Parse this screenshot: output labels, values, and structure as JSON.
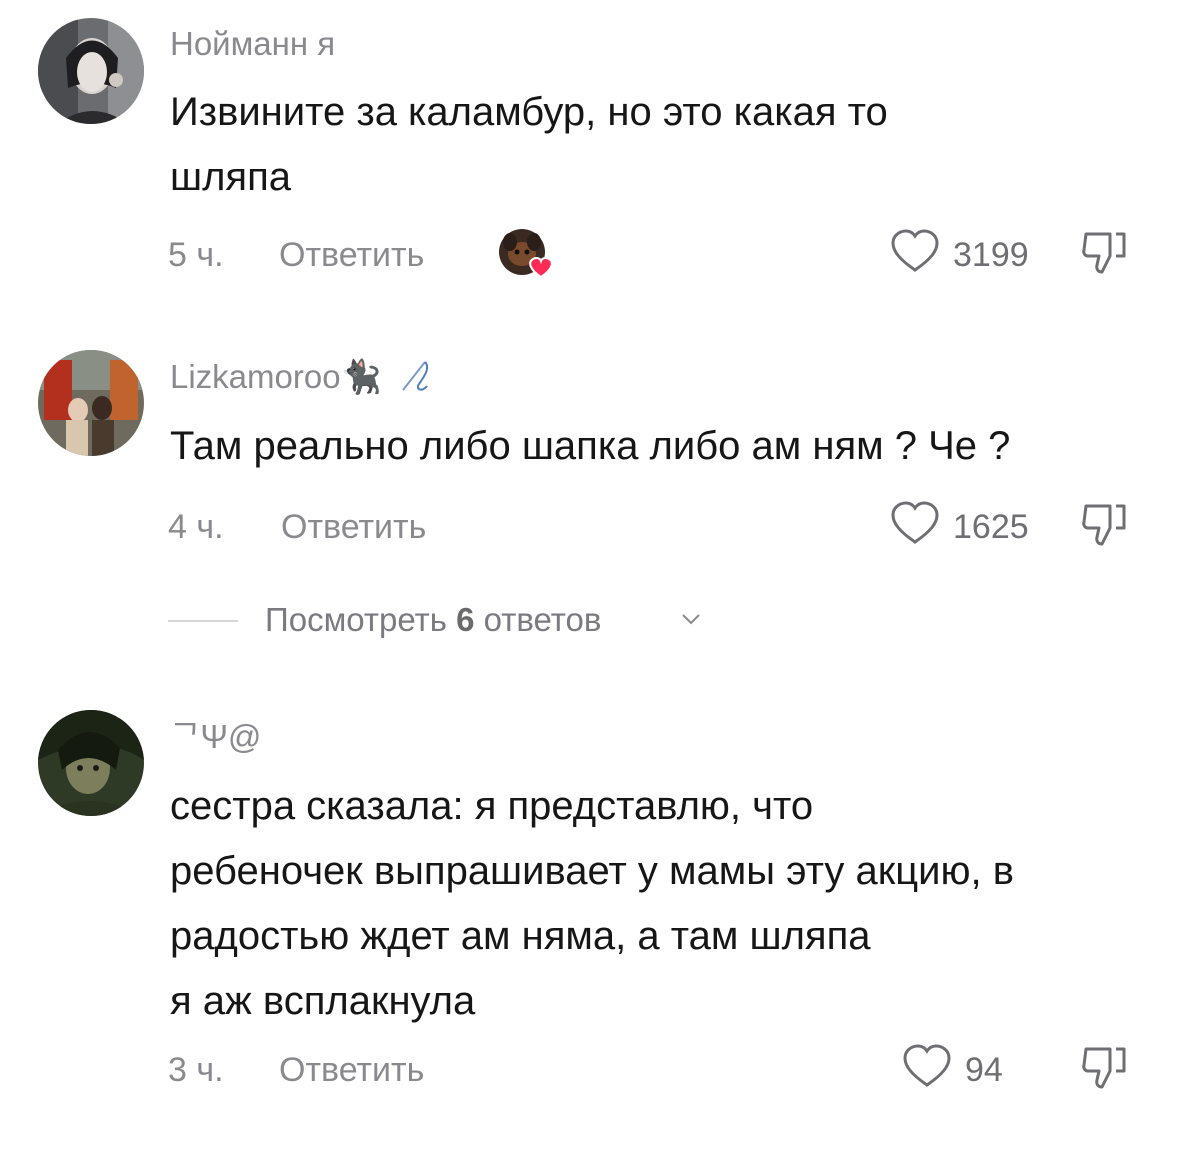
{
  "comments": [
    {
      "username": "Нойманн я",
      "lines": [
        "Извините за каламбур, но это какая то",
        "шляпа"
      ],
      "time": "5 ч.",
      "reply_label": "Ответить",
      "likes": "3199",
      "liked_by_creator": true
    },
    {
      "username": "Lizkamoroo🐈‍⬛",
      "lines": [
        "Там реально либо шапка либо ам ням ? Че ?"
      ],
      "time": "4 ч.",
      "reply_label": "Ответить",
      "likes": "1625"
    },
    {
      "username": "ᄀΨ@",
      "lines": [
        "сестра сказала: я представлю, что",
        "ребеночек выпрашивает у мамы эту акцию, в",
        "радостью ждет ам няма, а там шляпа",
        "я аж всплакнула"
      ],
      "time": "3 ч.",
      "reply_label": "Ответить",
      "likes": "94"
    }
  ],
  "view_replies": {
    "prefix": "Посмотреть ",
    "count": "6",
    "suffix": " ответов"
  },
  "icons": {
    "like": "heart-outline-icon",
    "dislike": "thumbs-down-icon",
    "chevron": "chevron-down-icon",
    "creator_like": "creator-liked-heart-icon"
  },
  "colors": {
    "text": "#161616",
    "muted": "#8a8a8e",
    "heart_badge": "#fe2c55"
  }
}
